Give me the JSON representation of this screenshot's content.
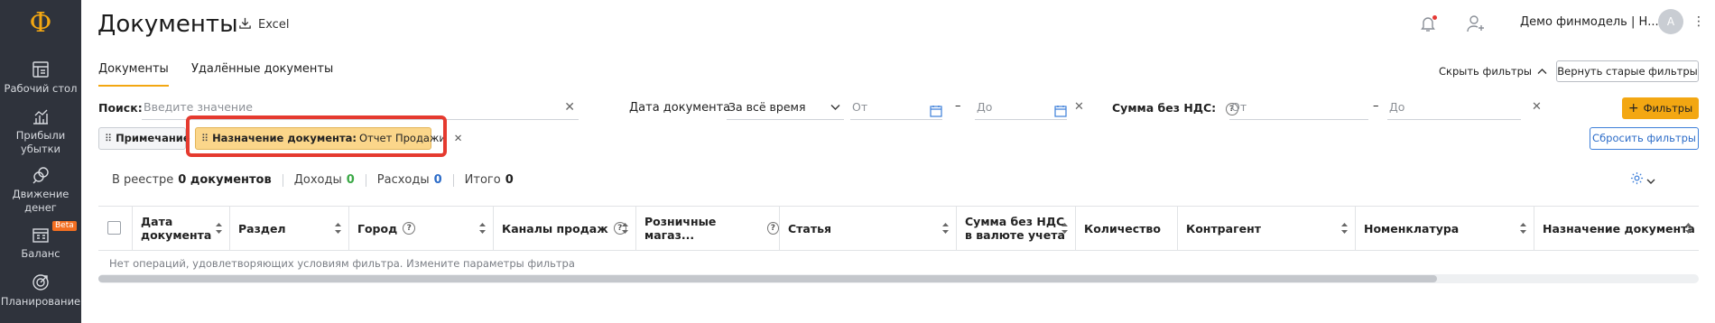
{
  "app": {
    "logo_glyph": "Ф",
    "accent_color": "#f3a712",
    "sidebar_color": "#2f333c"
  },
  "sidebar": {
    "items": [
      {
        "label": "Рабочий стол",
        "icon": "desk-icon"
      },
      {
        "label": "Прибыли убытки",
        "icon": "bar-chart-icon"
      },
      {
        "label": "Движение денег",
        "icon": "money-flow-icon"
      },
      {
        "label": "Баланс",
        "icon": "balance-icon",
        "badge": "Beta"
      },
      {
        "label": "Планирование",
        "icon": "target-icon"
      }
    ]
  },
  "header": {
    "title": "Документы",
    "excel_label": "Excel",
    "username": "Демо финмодель | Н...",
    "avatar_initial": "А"
  },
  "tabs": [
    {
      "label": "Документы",
      "active": true
    },
    {
      "label": "Удалённые документы",
      "active": false
    }
  ],
  "filters": {
    "hide_label": "Скрыть фильтры",
    "restore_old_label": "Вернуть старые фильтры",
    "search_label": "Поиск:",
    "search_placeholder": "Введите значение",
    "date_label": "Дата документа",
    "date_period": "За всё время",
    "date_from_placeholder": "От",
    "date_to_placeholder": "До",
    "dash": "–",
    "sum_label": "Сумма без НДС:",
    "sum_from_placeholder": "От",
    "sum_to_placeholder": "До",
    "add_filters_label": "Фильтры",
    "reset_label": "Сбросить фильтры",
    "chips": [
      {
        "label": "Примечание",
        "value": ""
      },
      {
        "label": "Назначение документа:",
        "value": "Отчет Продажи"
      }
    ]
  },
  "summary": {
    "registry_prefix": "В реестре",
    "registry_count": "0 документов",
    "income_label": "Доходы",
    "income_value": "0",
    "income_color": "#3aa845",
    "expense_label": "Расходы",
    "expense_value": "0",
    "expense_color": "#2c6cc8",
    "total_label": "Итого",
    "total_value": "0"
  },
  "table": {
    "columns": [
      "Дата документа",
      "Раздел",
      "Город",
      "Каналы продаж",
      "Розничные магаз...",
      "Статья",
      "Сумма без НДС в валюте учета",
      "Количество",
      "Контрагент",
      "Номенклатура",
      "Назначение документа"
    ],
    "empty_message": "Нет операций, удовлетворяющих условиям фильтра. Измените параметры фильтра",
    "scroll_position": 0.0
  }
}
